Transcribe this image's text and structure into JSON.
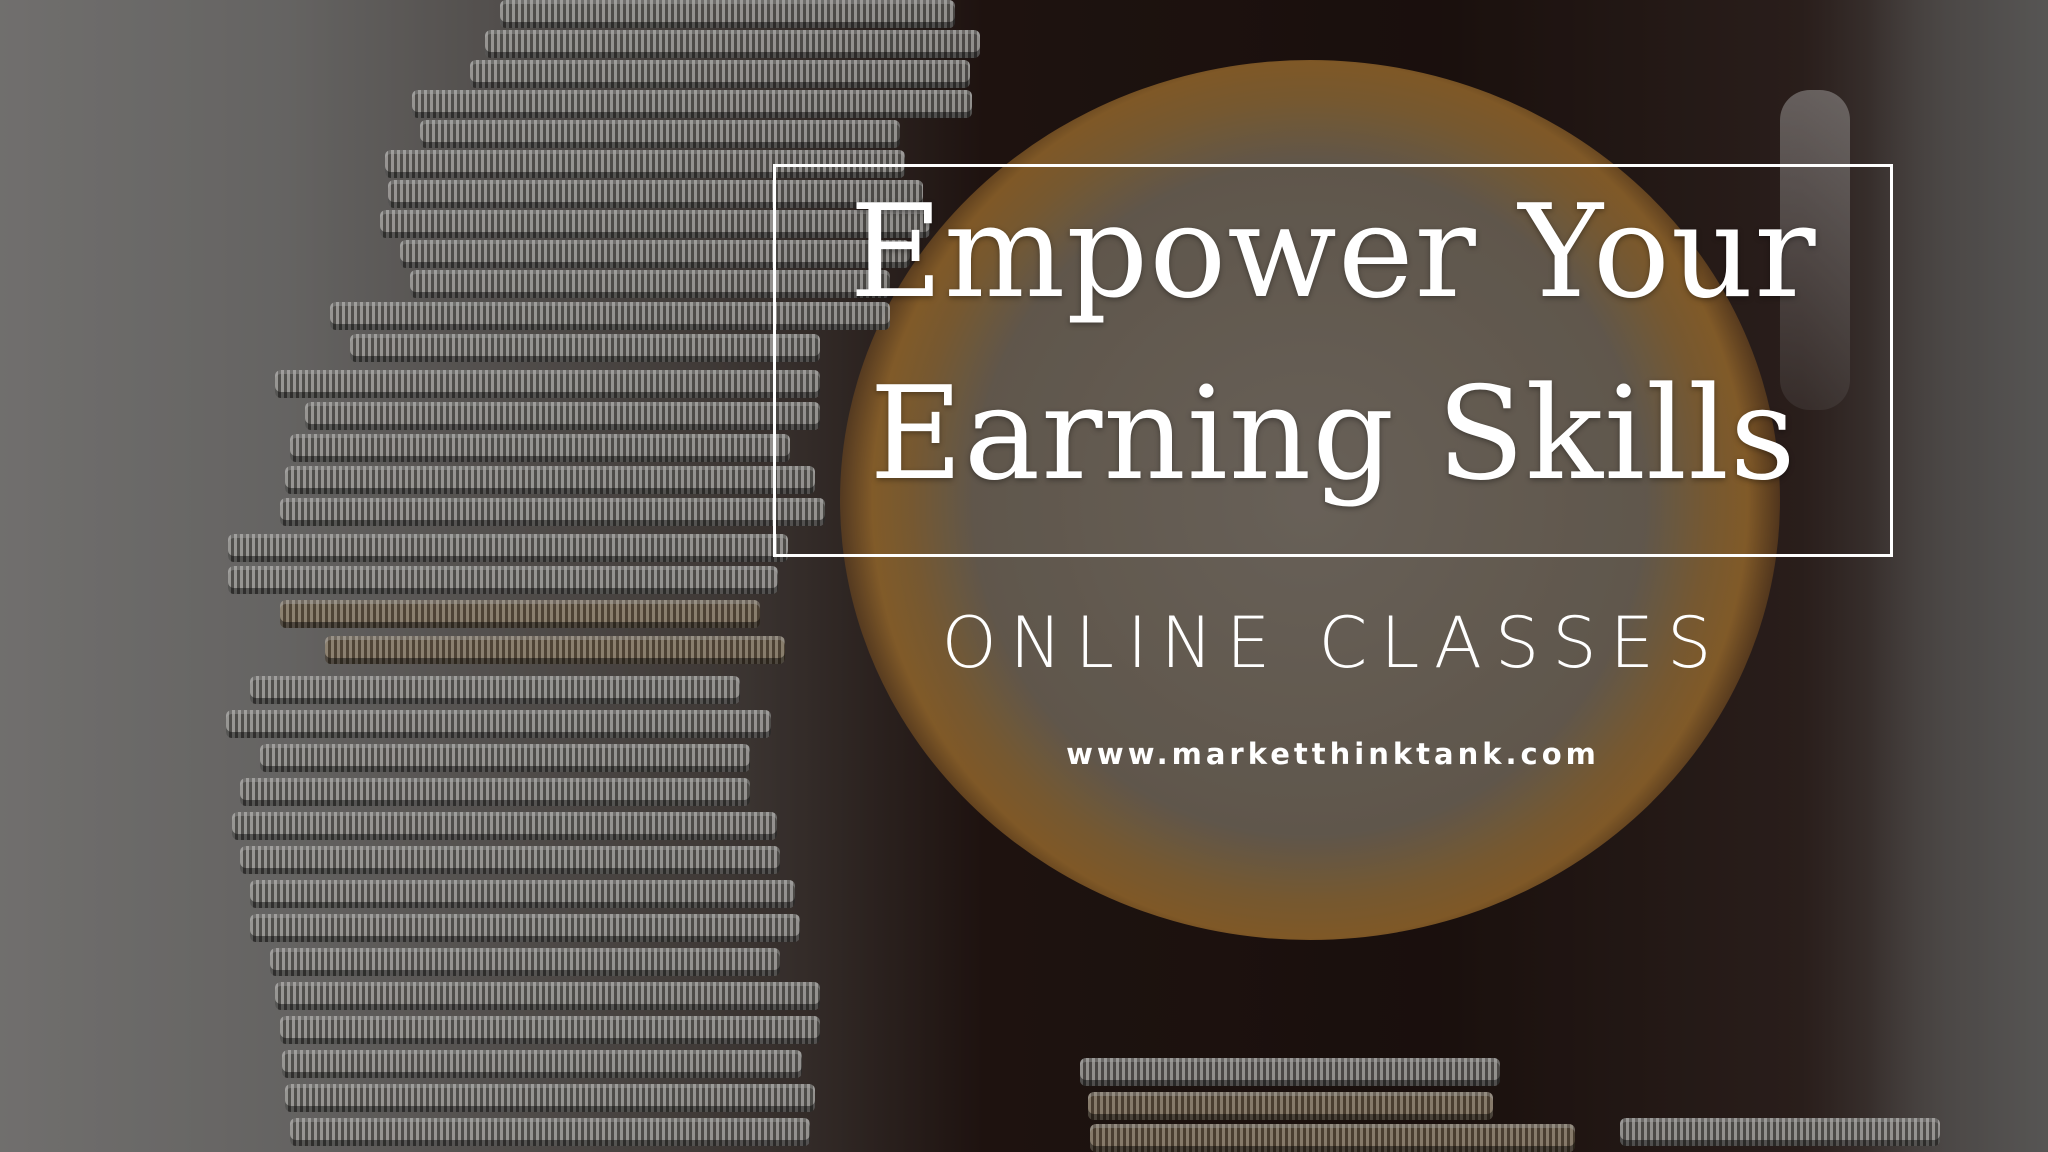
{
  "banner": {
    "title_line1": "Empower Your",
    "title_line2": "Earning Skills",
    "subtitle": "ONLINE CLASSES",
    "website": "www.marketthinktank.com"
  }
}
